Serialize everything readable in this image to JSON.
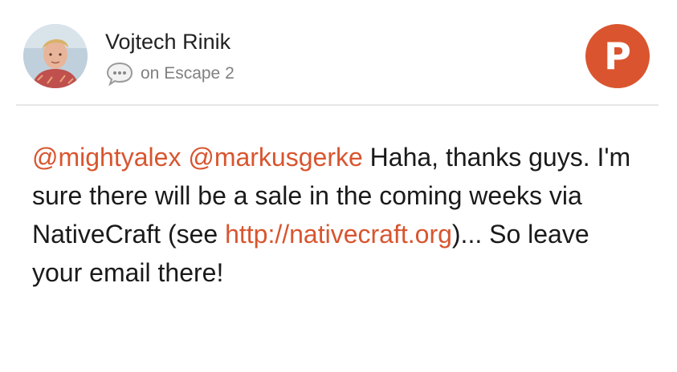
{
  "comment": {
    "author": "Vojtech Rinik",
    "context": "on Escape 2",
    "mentions": [
      "@mightyalex",
      "@markusgerke"
    ],
    "text_1": " Haha, thanks guys. I'm sure there will be a sale in the coming weeks via NativeCraft (see ",
    "link": "http://nativecraft.org",
    "text_2": ")... So leave your email there!"
  },
  "brand": {
    "logo_letter": "P",
    "color": "#da552f"
  },
  "icons": {
    "context": "speech-bubble-icon"
  },
  "colors": {
    "link": "#d8552f",
    "meta": "#808080"
  }
}
